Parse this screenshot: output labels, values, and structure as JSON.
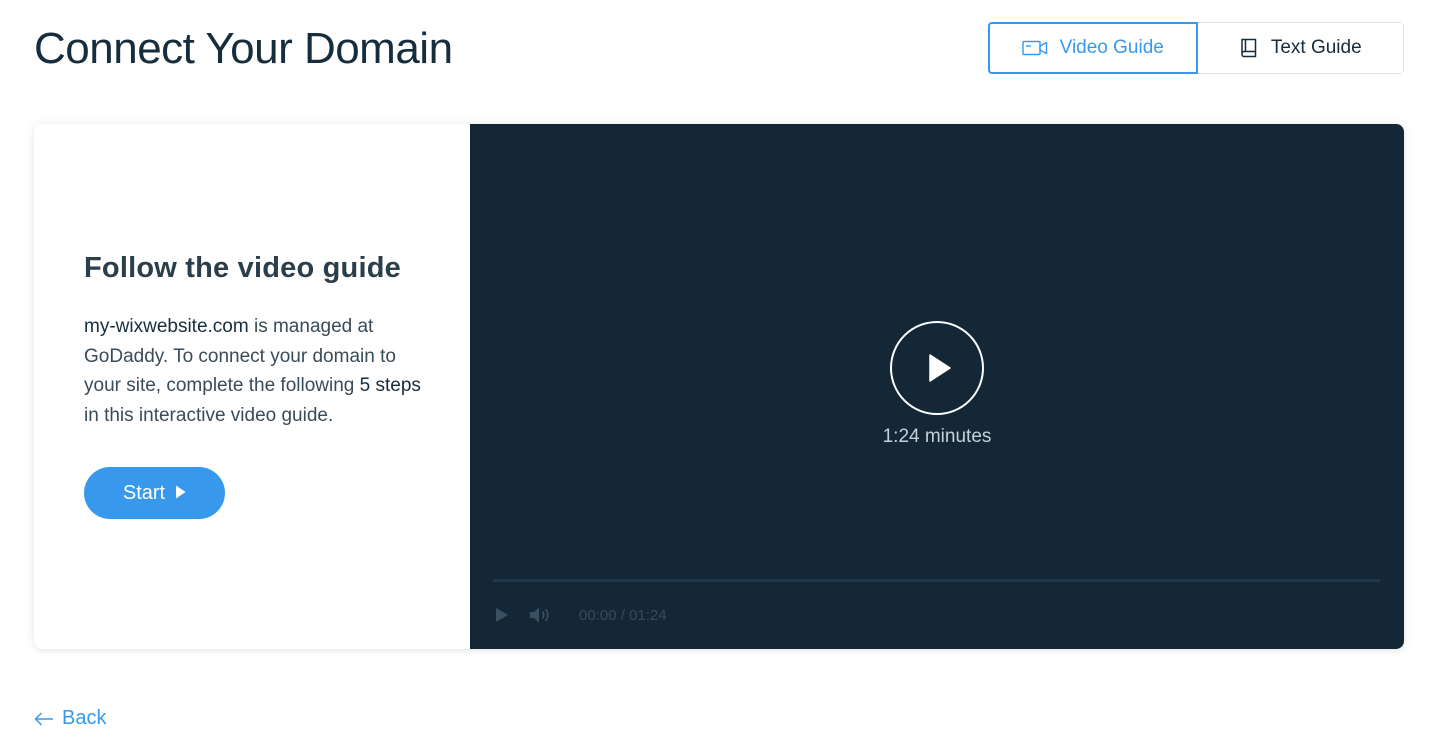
{
  "header": {
    "title": "Connect Your Domain"
  },
  "guide_toggle": {
    "video_label": "Video Guide",
    "text_label": "Text Guide",
    "active": "video"
  },
  "card": {
    "heading": "Follow the video guide",
    "domain": "my-wixwebsite.com",
    "text_1": " is managed at GoDaddy. To connect your domain to your site, complete the following ",
    "steps_strong": "5 steps",
    "text_2": " in this interactive video guide.",
    "start_label": "Start"
  },
  "video": {
    "duration_label": "1:24 minutes",
    "current_time": "00:00",
    "separator": "/",
    "total_time": "01:24",
    "progress": 0
  },
  "footer": {
    "back_label": "Back"
  },
  "colors": {
    "accent": "#3899ec",
    "video_bg": "#142736",
    "title": "#162d3d"
  },
  "icons": {
    "video_toggle": "video-camera-icon",
    "text_toggle": "book-icon",
    "start": "play-triangle-icon",
    "big_play": "play-icon",
    "control_play": "play-icon",
    "volume": "volume-icon",
    "back": "arrow-left-icon"
  }
}
